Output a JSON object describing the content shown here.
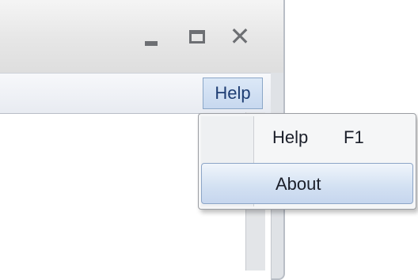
{
  "window": {
    "title_controls": {
      "minimize": "minimize-icon",
      "maximize": "maximize-icon",
      "close": "close-icon"
    }
  },
  "menubar": {
    "help_label": "Help"
  },
  "help_menu": {
    "items": [
      {
        "label": "Help",
        "shortcut": "F1"
      },
      {
        "label": "About",
        "highlighted": true
      }
    ]
  },
  "colors": {
    "menu_highlight": "#c7d8ef",
    "menu_text": "#1e3d73"
  }
}
